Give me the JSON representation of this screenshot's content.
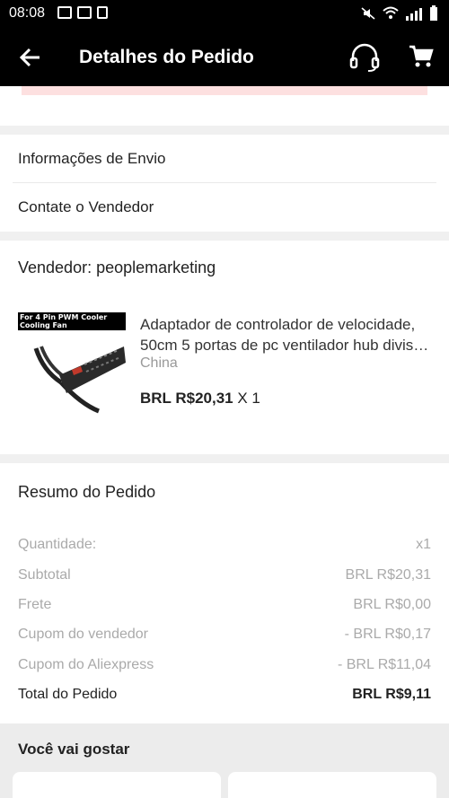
{
  "status_bar": {
    "time": "08:08"
  },
  "app_bar": {
    "title": "Detalhes do Pedido"
  },
  "menu": [
    {
      "label": "Informações de Envio"
    },
    {
      "label": "Contate o Vendedor"
    }
  ],
  "seller": {
    "label": "Vendedor: peoplemarketing",
    "product": {
      "image_banner": "For 4 Pin PWM Cooler Cooling Fan",
      "title_line1": "Adaptador de controlador de velocidade,",
      "title_line2": "50cm 5 portas de pc ventilador hub divis…",
      "origin": "China",
      "price": "BRL R$20,31",
      "qty": " X 1"
    }
  },
  "summary": {
    "title": "Resumo do Pedido",
    "rows": [
      {
        "label": "Quantidade:",
        "value": "x1"
      },
      {
        "label": "Subtotal",
        "value": "BRL R$20,31"
      },
      {
        "label": "Frete",
        "value": "BRL R$0,00"
      },
      {
        "label": "Cupom do vendedor",
        "value": "- BRL R$0,17"
      },
      {
        "label": "Cupom do Aliexpress",
        "value": "- BRL R$11,04"
      }
    ],
    "total": {
      "label": "Total do Pedido",
      "value": "BRL R$9,11"
    }
  },
  "recommend": {
    "title": "Você vai gostar"
  },
  "icons": {
    "back": "arrow-left-icon",
    "support": "headset-icon",
    "cart": "shopping-cart-icon"
  },
  "colors": {
    "appbar": "#000000",
    "accent_strip": "#fde0e0"
  }
}
